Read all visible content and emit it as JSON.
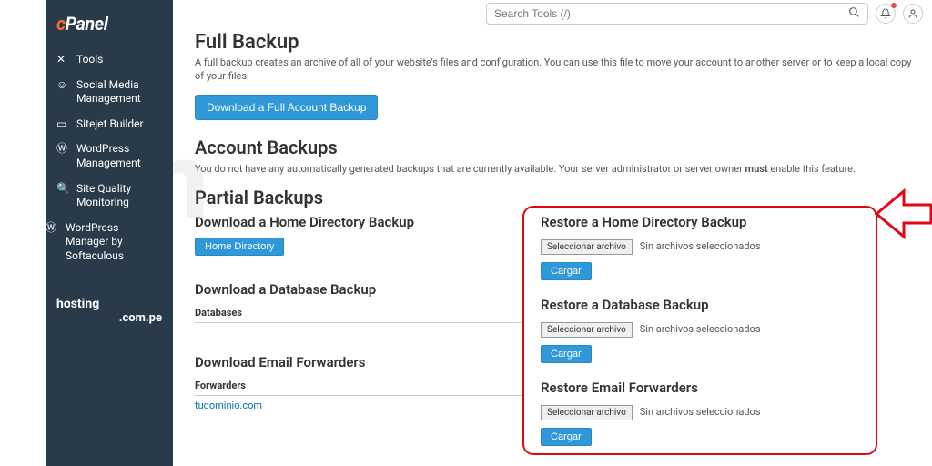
{
  "logo": "cPanel",
  "search": {
    "placeholder": "Search Tools (/)"
  },
  "sidebar": {
    "items": [
      {
        "icon": "✕",
        "label": "Tools"
      },
      {
        "icon": "☺",
        "label": "Social Media Management"
      },
      {
        "icon": "▭",
        "label": "Sitejet Builder"
      },
      {
        "icon": "Ⓦ",
        "label": "WordPress Management"
      },
      {
        "icon": "🔍",
        "label": "Site Quality Monitoring"
      },
      {
        "icon": "Ⓦ",
        "label": "WordPress Manager by Softaculous"
      }
    ],
    "brand": {
      "line1": "hosting",
      "line2": ".com.pe"
    }
  },
  "full": {
    "title": "Full Backup",
    "desc": "A full backup creates an archive of all of your website's files and configuration. You can use this file to move your account to another server or to keep a local copy of your files.",
    "button": "Download a Full Account Backup"
  },
  "account": {
    "title": "Account Backups",
    "desc_a": "You do not have any automatically generated backups that are currently available. Your server administrator or server owner ",
    "desc_b": "must",
    "desc_c": " enable this feature."
  },
  "partial": {
    "title": "Partial Backups",
    "dl_home": {
      "title": "Download a Home Directory Backup",
      "button": "Home Directory"
    },
    "rs_home": {
      "title": "Restore a Home Directory Backup",
      "choose": "Seleccionar archivo",
      "nofile": "Sin archivos seleccionados",
      "upload": "Cargar"
    },
    "dl_db": {
      "title": "Download a Database Backup",
      "col": "Databases"
    },
    "rs_db": {
      "title": "Restore a Database Backup",
      "choose": "Seleccionar archivo",
      "nofile": "Sin archivos seleccionados",
      "upload": "Cargar"
    },
    "dl_fw": {
      "title": "Download Email Forwarders",
      "col": "Forwarders",
      "row": "tudominio.com"
    },
    "rs_fw": {
      "title": "Restore Email Forwarders",
      "choose": "Seleccionar archivo",
      "nofile": "Sin archivos seleccionados",
      "upload": "Cargar"
    }
  }
}
